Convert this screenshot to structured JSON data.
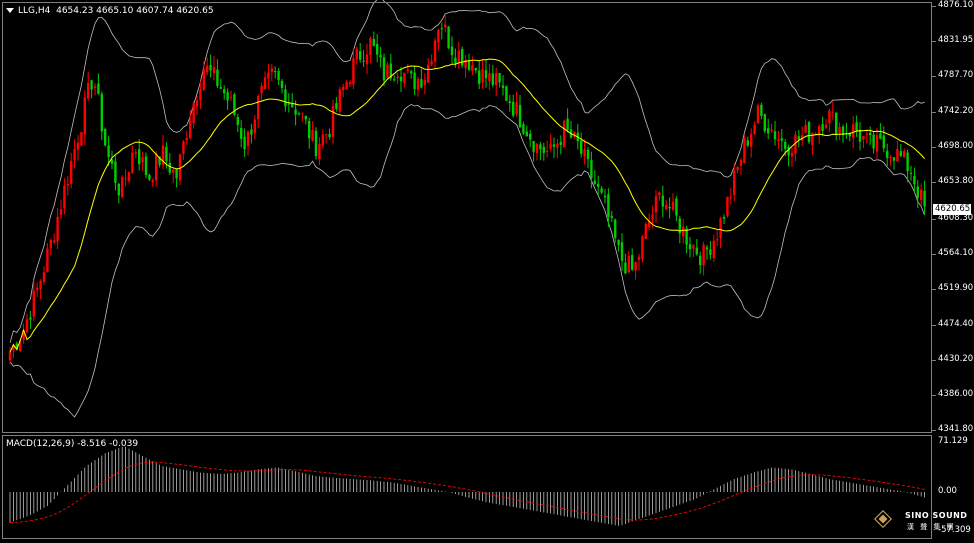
{
  "main_header": {
    "symbol": "LLG,H4",
    "ohlc": "4654.23 4665.10 4607.74 4620.65"
  },
  "macd_header": {
    "label": "MACD(12,26,9) -8.516 -0.039"
  },
  "price_axis": {
    "labels": [
      "4876.10",
      "4831.95",
      "4787.70",
      "4742.20",
      "4698.00",
      "4653.80",
      "4608.30",
      "4564.10",
      "4519.90",
      "4474.40",
      "4430.20",
      "4386.00",
      "4341.80"
    ],
    "current_price": "4620.65"
  },
  "macd_axis": {
    "labels": [
      "71.129",
      "0.00",
      "-57.309"
    ]
  },
  "logo": {
    "title": "SINO SOUND",
    "subtitle": "漢 聲 集 團"
  },
  "chart_data": {
    "type": "candlestick",
    "symbol": "LLG",
    "timeframe": "H4",
    "ylim": [
      4341.8,
      4876.1
    ],
    "colors": {
      "up": "#ff0000",
      "down": "#00cc00",
      "ma": "#ffff00",
      "bands": "#c0c0c0",
      "macd_hist": "#c0c0c0",
      "macd_signal": "#ff0000"
    },
    "close_path": [
      4440,
      4470,
      4520,
      4580,
      4650,
      4720,
      4790,
      4690,
      4640,
      4700,
      4660,
      4690,
      4660,
      4740,
      4800,
      4780,
      4750,
      4700,
      4760,
      4790,
      4760,
      4740,
      4700,
      4720,
      4770,
      4810,
      4830,
      4790,
      4800,
      4780,
      4790,
      4860,
      4820,
      4810,
      4790,
      4780,
      4760,
      4730,
      4700,
      4690,
      4720,
      4700,
      4660,
      4620,
      4560,
      4540,
      4600,
      4640,
      4610,
      4580,
      4560,
      4590,
      4640,
      4700,
      4740,
      4720,
      4700,
      4710,
      4720,
      4740,
      4720,
      4720,
      4700,
      4700,
      4690,
      4670,
      4620
    ],
    "macd_path": [
      -45,
      -35,
      -20,
      10,
      40,
      60,
      71,
      55,
      40,
      35,
      30,
      28,
      30,
      35,
      38,
      32,
      25,
      22,
      20,
      18,
      15,
      10,
      5,
      0,
      -8,
      -15,
      -20,
      -25,
      -30,
      -35,
      -40,
      -45,
      -50,
      -40,
      -30,
      -20,
      -10,
      5,
      20,
      30,
      38,
      35,
      28,
      20,
      15,
      10,
      5,
      0,
      -8
    ]
  }
}
